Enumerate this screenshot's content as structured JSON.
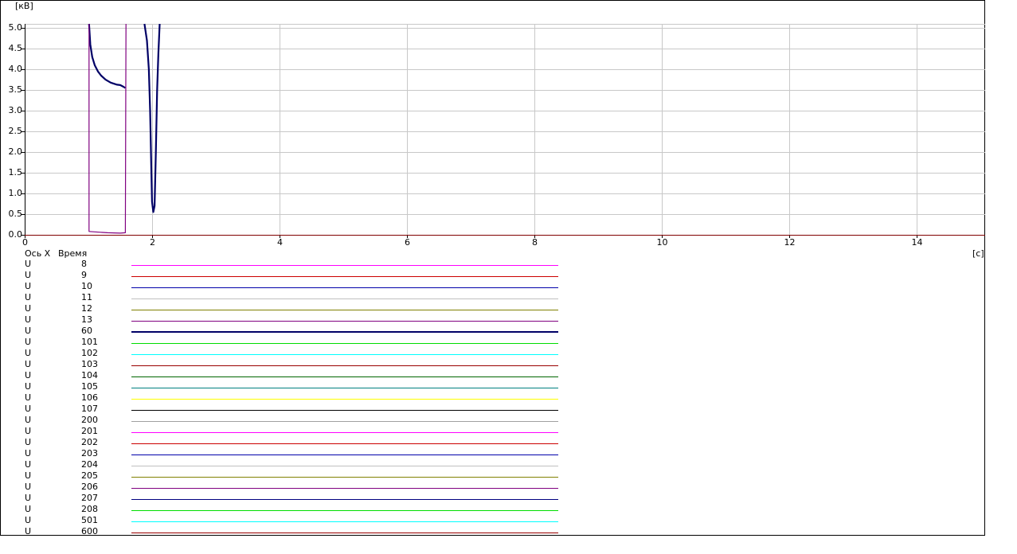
{
  "chart_data": {
    "type": "line",
    "ylabel": "[кВ]",
    "xlabel": "[с]",
    "xlim": [
      0,
      15.08
    ],
    "ylim": [
      0,
      5.1
    ],
    "x_ticks": [
      "0",
      "2",
      "4",
      "6",
      "8",
      "10",
      "12",
      "14"
    ],
    "y_ticks": [
      "0.0",
      "0.5",
      "1.0",
      "1.5",
      "2.0",
      "2.5",
      "3.0",
      "3.5",
      "4.0",
      "4.5",
      "5.0"
    ],
    "grid": true,
    "series": [
      {
        "name": "60",
        "color": "#000066",
        "points": [
          [
            1.01,
            5.1
          ],
          [
            1.03,
            4.6
          ],
          [
            1.06,
            4.3
          ],
          [
            1.1,
            4.1
          ],
          [
            1.15,
            3.95
          ],
          [
            1.2,
            3.85
          ],
          [
            1.27,
            3.75
          ],
          [
            1.35,
            3.68
          ],
          [
            1.45,
            3.63
          ],
          [
            1.5,
            3.62
          ],
          [
            1.55,
            3.58
          ],
          [
            1.58,
            3.55
          ]
        ]
      },
      {
        "name": "60",
        "color": "#000066",
        "points": [
          [
            1.88,
            5.1
          ],
          [
            1.92,
            4.7
          ],
          [
            1.95,
            4.0
          ],
          [
            1.97,
            3.0
          ],
          [
            1.99,
            1.5
          ],
          [
            2.0,
            0.8
          ],
          [
            2.02,
            0.55
          ],
          [
            2.04,
            0.7
          ],
          [
            2.06,
            2.0
          ],
          [
            2.08,
            3.5
          ],
          [
            2.1,
            4.4
          ],
          [
            2.12,
            5.1
          ]
        ]
      },
      {
        "name": "13",
        "color": "#800080",
        "points": [
          [
            1.01,
            5.1
          ],
          [
            1.01,
            0.08
          ],
          [
            1.3,
            0.05
          ],
          [
            1.5,
            0.04
          ],
          [
            1.58,
            0.05
          ],
          [
            1.59,
            5.1
          ]
        ]
      }
    ],
    "x_axis": {
      "name": "Ось X",
      "quantity": "Время"
    },
    "legend": [
      {
        "var": "U",
        "num": "8",
        "color": "#ff00ff"
      },
      {
        "var": "U",
        "num": "9",
        "color": "#cc0000"
      },
      {
        "var": "U",
        "num": "10",
        "color": "#0000aa"
      },
      {
        "var": "U",
        "num": "11",
        "color": "#c0c0c0"
      },
      {
        "var": "U",
        "num": "12",
        "color": "#808000"
      },
      {
        "var": "U",
        "num": "13",
        "color": "#800080"
      },
      {
        "var": "U",
        "num": "60",
        "color": "#000066"
      },
      {
        "var": "U",
        "num": "101",
        "color": "#00dd00"
      },
      {
        "var": "U",
        "num": "102",
        "color": "#00ffff"
      },
      {
        "var": "U",
        "num": "103",
        "color": "#990000"
      },
      {
        "var": "U",
        "num": "104",
        "color": "#006600"
      },
      {
        "var": "U",
        "num": "105",
        "color": "#008080"
      },
      {
        "var": "U",
        "num": "106",
        "color": "#ffff00"
      },
      {
        "var": "U",
        "num": "107",
        "color": "#000000"
      },
      {
        "var": "U",
        "num": "200",
        "color": "#a0a0a0"
      },
      {
        "var": "U",
        "num": "201",
        "color": "#ff00ff"
      },
      {
        "var": "U",
        "num": "202",
        "color": "#cc0000"
      },
      {
        "var": "U",
        "num": "203",
        "color": "#0000aa"
      },
      {
        "var": "U",
        "num": "204",
        "color": "#c0c0c0"
      },
      {
        "var": "U",
        "num": "205",
        "color": "#808000"
      },
      {
        "var": "U",
        "num": "206",
        "color": "#800080"
      },
      {
        "var": "U",
        "num": "207",
        "color": "#000080"
      },
      {
        "var": "U",
        "num": "208",
        "color": "#00dd00"
      },
      {
        "var": "U",
        "num": "501",
        "color": "#00ffff"
      },
      {
        "var": "U",
        "num": "600",
        "color": "#990000"
      }
    ]
  }
}
